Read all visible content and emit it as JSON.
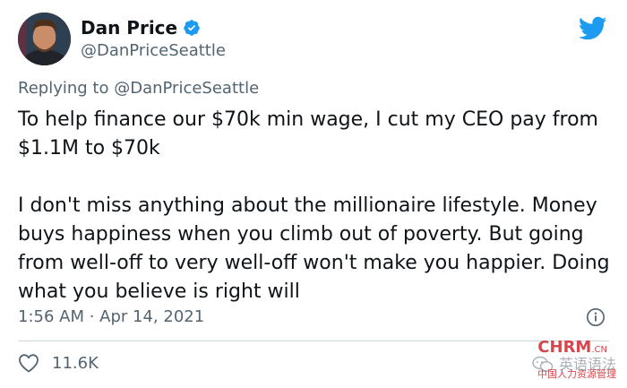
{
  "author": {
    "display_name": "Dan Price",
    "handle": "@DanPriceSeattle",
    "verified": true
  },
  "reply": {
    "prefix": "Replying to",
    "handle": "@DanPriceSeattle"
  },
  "tweet": {
    "text": "To help finance our $70k min wage, I cut my CEO pay from $1.1M to $70k\n\nI don't miss anything about the millionaire lifestyle. Money buys happiness when you climb out of poverty. But going from well-off to very well-off won't make you happier. Doing what you believe is right will",
    "timestamp": "1:56 AM · Apr 14, 2021"
  },
  "engagement": {
    "likes": "11.6K"
  },
  "watermark": {
    "text": "英语语法",
    "logo": "CHRM",
    "logo_suffix": ".CN",
    "sub": "中国人力资源管理"
  },
  "colors": {
    "brand_blue": "#1d9bf0",
    "text_primary": "#0f1419",
    "text_secondary": "#536471",
    "divider": "#cfd9de",
    "watermark_red": "#d0282e"
  },
  "icons": [
    "verified-badge-icon",
    "twitter-bird-icon",
    "info-icon",
    "heart-icon",
    "wechat-icon"
  ]
}
